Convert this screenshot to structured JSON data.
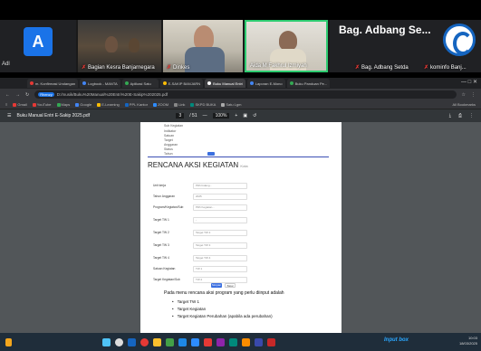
{
  "meeting": {
    "tile_a_initial": "A",
    "tile_left_name": "Adl",
    "tile1_name": "Bagian Kesra Banjarnegara",
    "tile2_name": "Dinkes",
    "tile3_name": "Aida M Fakhrul Izmiyah",
    "bag_title": "Bag. Adbang Se...",
    "bag_label": "Bag. Adbang Setda",
    "right_label": "kominfo Banj..."
  },
  "browser": {
    "tabs": [
      {
        "label": "m. Konfirmasi Undangan"
      },
      {
        "label": "Logbook - MANTA"
      },
      {
        "label": "Aplikasi Satu"
      },
      {
        "label": "E-SAKIP BANJARN"
      },
      {
        "label": "Buku Manual Entri"
      },
      {
        "label": "Laporan E-Mono"
      },
      {
        "label": "Buku Panduan Pe..."
      }
    ],
    "url_chip": "Rhenzy",
    "url": "D:/musik/Buku%20Manual%20Entri%20E-Sakip%202025.pdf",
    "bookmarks": [
      "Gmail",
      "YouTube",
      "Maps",
      "Google",
      "E-Learning",
      "PPL Kantor",
      "ZOOM",
      "Link",
      "SKPD BUKA",
      "Satu Lgm"
    ],
    "all_bookmarks": "All Bookmarks"
  },
  "pdf": {
    "file_name": "Buku Manual Entri E-Sakip 2025.pdf",
    "page_current": "3",
    "page_total": "/ 51",
    "zoom": "100%",
    "section_title": "RENCANA AKSI KEGIATAN",
    "section_sub": "Kota",
    "top_fields": [
      "Sub Kegiatan",
      "Indikator",
      "Satuan",
      "Target",
      "Anggaran",
      "Status",
      "Tahun"
    ],
    "fields": [
      {
        "label": "Unit kerja",
        "value": "Pilih bidang..."
      },
      {
        "label": "Tahun Anggaran",
        "value": "2025"
      },
      {
        "label": "Program/Kegiatan/Sub",
        "value": "Pilih Kegiatan..."
      },
      {
        "label": "Target TW 1",
        "value": "-"
      },
      {
        "label": "Target TW 2",
        "value": "Target TW 2"
      },
      {
        "label": "Target TW 3",
        "value": "Target TW 3"
      },
      {
        "label": "Target TW 4",
        "value": "Target TW 4"
      },
      {
        "label": "Satuan Kegiatan",
        "value": "TW 1"
      },
      {
        "label": "Target Kegiatan/Sub",
        "value": "TW 2"
      }
    ],
    "save_label": "Simpan",
    "cancel_label": "Batal",
    "note": "Pada menu rencana aksi program yang perlu diinput adalah",
    "bullets": [
      "Target TW 1",
      "Target Kegiatan",
      "Target Kegiatan Perubahan (apabila ada perubahan)"
    ]
  },
  "taskbar": {
    "notif": "Input box",
    "time": "10:03",
    "date": "18/03/2025"
  }
}
